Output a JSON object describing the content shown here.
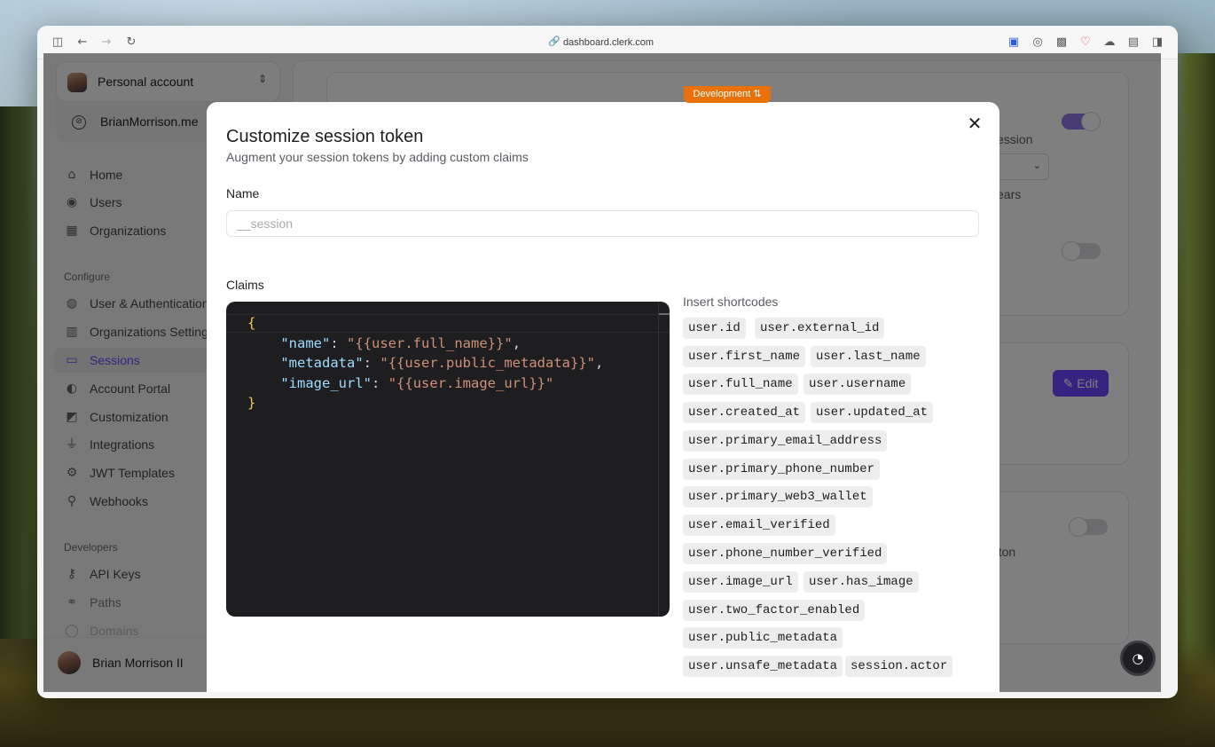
{
  "browser": {
    "url": "dashboard.clerk.com"
  },
  "environment_badge": "Development ⇅",
  "sidebar": {
    "account_switcher": {
      "label": "Personal account"
    },
    "application": {
      "name": "BrianMorrison.me"
    },
    "nav_main": [
      {
        "label": "Home",
        "icon": "home-icon"
      },
      {
        "label": "Users",
        "icon": "users-icon"
      },
      {
        "label": "Organizations",
        "icon": "organizations-icon"
      }
    ],
    "configure_label": "Configure",
    "nav_configure": [
      {
        "label": "User & Authentication",
        "icon": "fingerprint-icon"
      },
      {
        "label": "Organizations Settings",
        "icon": "building-icon"
      },
      {
        "label": "Sessions",
        "icon": "sessions-icon",
        "active": true
      },
      {
        "label": "Account Portal",
        "icon": "portal-icon"
      },
      {
        "label": "Customization",
        "icon": "customization-icon"
      },
      {
        "label": "Integrations",
        "icon": "plug-icon"
      },
      {
        "label": "JWT Templates",
        "icon": "gear-icon"
      },
      {
        "label": "Webhooks",
        "icon": "webhook-icon"
      }
    ],
    "developers_label": "Developers",
    "nav_developers": [
      {
        "label": "API Keys",
        "icon": "key-icon"
      },
      {
        "label": "Paths",
        "icon": "link-icon"
      },
      {
        "label": "Domains",
        "icon": "globe-icon"
      }
    ],
    "user": {
      "name": "Brian Morrison II"
    }
  },
  "background_page": {
    "text_session": "ession",
    "text_years": "ears",
    "text_button": "utton",
    "edit_button": "Edit"
  },
  "modal": {
    "title": "Customize session token",
    "subtitle": "Augment your session tokens by adding custom claims",
    "name_label": "Name",
    "name_placeholder": "__session",
    "claims_label": "Claims",
    "claims_code": [
      {
        "key": "name",
        "value": "{{user.full_name}}"
      },
      {
        "key": "metadata",
        "value": "{{user.public_metadata}}"
      },
      {
        "key": "image_url",
        "value": "{{user.image_url}}"
      }
    ],
    "shortcodes_label": "Insert shortcodes",
    "shortcodes": [
      "user.id",
      "user.external_id",
      "user.first_name",
      "user.last_name",
      "user.full_name",
      "user.username",
      "user.created_at",
      "user.updated_at",
      "user.primary_email_address",
      "user.primary_phone_number",
      "user.primary_web3_wallet",
      "user.email_verified",
      "user.phone_number_verified",
      "user.image_url",
      "user.has_image",
      "user.two_factor_enabled",
      "user.public_metadata",
      "user.unsafe_metadata",
      "session.actor"
    ]
  }
}
